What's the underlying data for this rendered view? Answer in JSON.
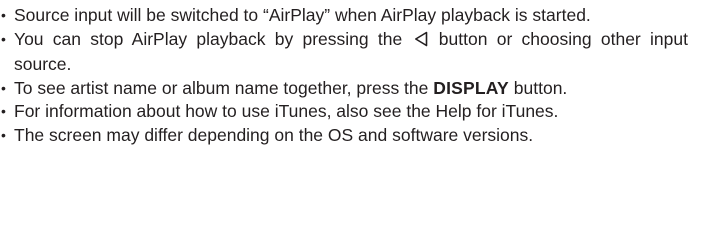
{
  "notes": {
    "bullet": "•",
    "items": [
      {
        "text": "Source input will be switched to “AirPlay” when AirPlay playback is started."
      },
      {
        "text_before": "You can stop AirPlay playback by pressing the",
        "icon": "back-triangle-icon",
        "text_after": "button or choosing other input source."
      },
      {
        "text_before": "To see artist name or album name together, press the",
        "strong": "DISPLAY",
        "text_after": "button."
      },
      {
        "text": "For information about how to use iTunes, also see the Help for iTunes."
      },
      {
        "text": "The screen may differ depending on the OS and software versions."
      }
    ]
  }
}
